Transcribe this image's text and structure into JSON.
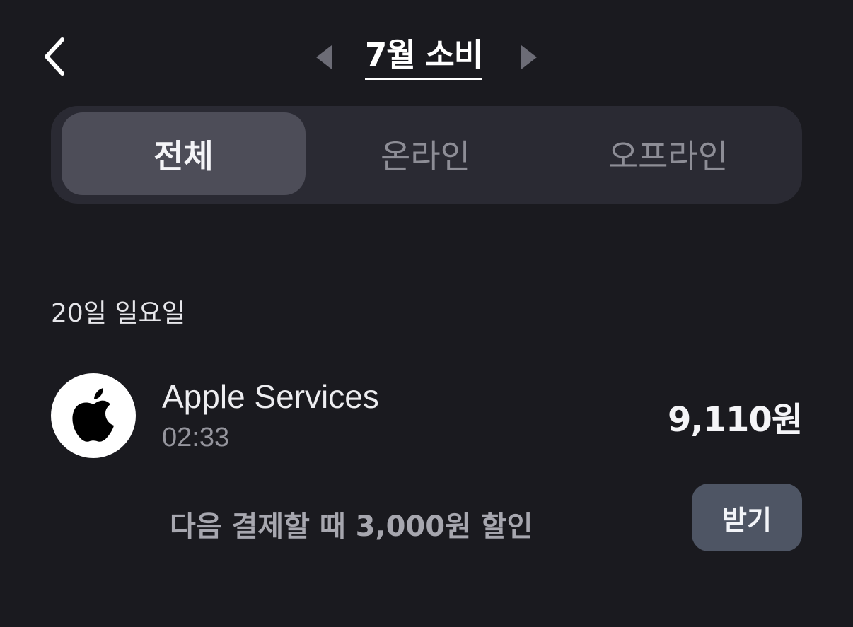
{
  "header": {
    "title": "7월 소비",
    "back_icon": "chevron-left-icon",
    "prev_icon": "triangle-left-icon",
    "next_icon": "triangle-right-icon"
  },
  "tabs": [
    {
      "label": "전체",
      "selected": true
    },
    {
      "label": "온라인",
      "selected": false
    },
    {
      "label": "오프라인",
      "selected": false
    }
  ],
  "transactions": {
    "date_header": "20일 일요일",
    "items": [
      {
        "merchant": "Apple Services",
        "time": "02:33",
        "amount": "9,110원",
        "logo_icon": "apple-logo-icon"
      }
    ]
  },
  "promo": {
    "text": "다음 결제할 때 3,000원 할인",
    "button_label": "받기"
  },
  "colors": {
    "background": "#1a1a1f",
    "segment_bg": "#2a2a33",
    "segment_active": "#4d4d58",
    "button_bg": "#4e5564"
  }
}
